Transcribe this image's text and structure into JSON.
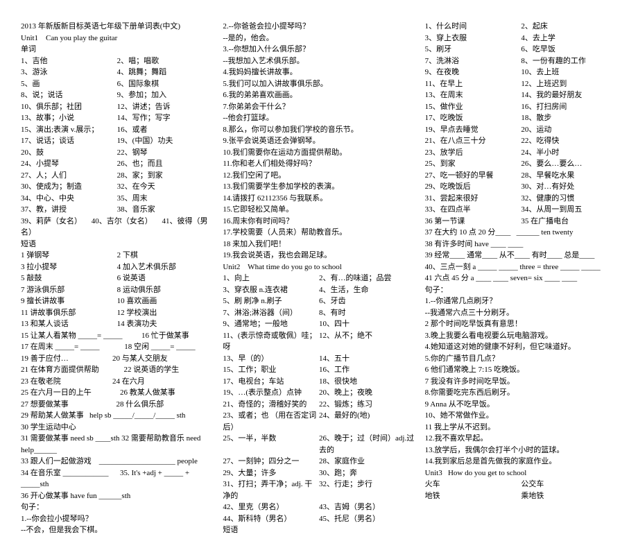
{
  "col1": {
    "title": "2013 年新版新目标英语七年级下册单词表(中文)",
    "unit": "Unit1    Can you play the guitar",
    "section1": "单词",
    "pairs": [
      [
        "1、吉他",
        "2、唱；唱歌"
      ],
      [
        "3、游泳",
        "4、跳舞；舞蹈"
      ],
      [
        "5、画",
        "6、国际象棋"
      ],
      [
        "8、说；说话",
        "9、参加；加入"
      ],
      [
        "10、俱乐部；社团",
        "12、讲述；告诉"
      ],
      [
        "13、故事；小说",
        "14、写作；写字"
      ],
      [
        "15、演出;表演  v.展示；",
        "16、或者"
      ],
      [
        "17、说话；谈话",
        "19、(中国）功夫"
      ],
      [
        "20、鼓",
        "22、钢琴"
      ],
      [
        "24、小提琴",
        "26、也；而且"
      ],
      [
        "27、人；人们",
        "28、家；到家"
      ],
      [
        "30、使成为；制造",
        "32、在今天"
      ],
      [
        "34、中心、中央",
        "35、周末"
      ],
      [
        "37、教，讲授",
        "38、音乐家"
      ]
    ],
    "line_names": "39、莉萨（女名）     40、吉尔（女名）     41、彼得（男名）",
    "section2": "短语",
    "phrase_pairs": [
      [
        "1 弹钢琴",
        "2 下棋"
      ],
      [
        "3 拉小提琴",
        "4 加入艺术俱乐部"
      ],
      [
        "5 敲鼓",
        "6 说英语"
      ],
      [
        "7 游泳俱乐部",
        "8 运动俱乐部"
      ],
      [
        "9 擅长讲故事",
        "10 喜欢画画"
      ],
      [
        "11 讲故事俱乐部",
        "12 学校演出"
      ],
      [
        "13 和某人谈话",
        "14 表演功夫"
      ]
    ],
    "more_lines": [
      "15 让某人看某物 _____= _____          16 忙于做某事",
      "17 在周末 _____= _____             18 空闲 _____= _____",
      "19 善于应付…                       20 与某人交朋友",
      "21 在体育方面提供帮助             22 说英语的学生",
      "23 在敬老院                           24 在六月",
      "25 在六月一日的上午               26 教某人做某事",
      "27 想要做某事                         28 什么俱乐部",
      "29 帮助某人做某事   help sb _____/_____/_____ sth",
      "30 学生运动中心",
      "31 需要做某事 need sb ____sth 32 需要帮助教音乐 need help______",
      "33 跟人们一起做游戏    ____________________ people",
      "34 在音乐室 ____________      35. It's +adj + _____ + _____sth",
      "36 开心做某事 have fun ______sth",
      "句子：",
      "1.--你会拉小提琴吗？",
      "--不会，但是我会下棋。"
    ]
  },
  "col2": {
    "lines": [
      "2.--你爸爸会拉小提琴吗？",
      "--是的，他会。",
      "3.--你想加入什么俱乐部？",
      "--我想加入艺术俱乐部。",
      "4.我妈妈擅长讲故事。",
      "5.我们可以加入讲故事俱乐部。",
      "6.我的弟弟喜欢画画。",
      "7.你弟弟会干什么？",
      "--他会打篮球。",
      "8.那么，你可以参加我们学校的音乐节。",
      "9.张平会说英语还会弹钢琴。",
      "10.我们需要你在运动方面提供帮助。",
      "11.你和老人们相处得好吗？",
      "12.我们空闲了吧。",
      "13.我们需要学生参加学校的表演。",
      "14.请拨打 62112356 与我联系。",
      "15.它即轻松又简单。",
      "16.周末你有时间吗？",
      "17.学校需要（人员来）帮助教音乐。",
      "18 来加入我们吧！",
      "19.我会说英语，我也会踢足球。",
      "",
      "Unit2    What time do you go to school"
    ],
    "pairs": [
      [
        "1、向上",
        "2、有…的味道；品尝"
      ],
      [
        "3、穿衣服  n.连衣裙",
        "4、生活，生命"
      ],
      [
        "5、刷 刷净  n.刷子",
        "6、牙齿"
      ],
      [
        "7、淋浴;淋浴器（间）",
        "8、有时"
      ],
      [
        "9、通常地；一般地",
        "10、四十"
      ],
      [
        "11、(表示惊奇或敬佩）哇；呀",
        "12、从不；绝不"
      ],
      [
        "13、早（的）",
        "14、五十"
      ],
      [
        "15、工作；职业",
        "16、工作"
      ],
      [
        "17、电视台；车站",
        "18、很快地"
      ],
      [
        "19、…(表示整点）点钟",
        "20、晚上；夜晚"
      ],
      [
        "21、奇怪的；滑稽好笑的",
        "22、锻炼；练习"
      ],
      [
        "23、或者；也 （用在否定词后）",
        "24、最好的(地)"
      ],
      [
        "25、一半，半数",
        "26、晚于；过（时间）adj.过去的"
      ],
      [
        "27、一刻钟；四分之一",
        "28、家庭作业"
      ],
      [
        "29、大量；许多",
        "30、跑；奔"
      ],
      [
        "31、打扫；弄干净；adj. 干净的",
        "32、行走；步行"
      ],
      [
        "42、里克（男名）",
        "43、吉姆（男名）"
      ],
      [
        "44、斯科特（男名）",
        "45、托尼（男名）"
      ]
    ],
    "footer": "短语"
  },
  "col3": {
    "pairs": [
      [
        "1、什么时间",
        "2、起床"
      ],
      [
        "3、穿上衣服",
        "4、去上学"
      ],
      [
        "5、刷牙",
        "6、吃早饭"
      ],
      [
        "7、洗淋浴",
        "8、一份有趣的工作"
      ],
      [
        "9、在夜晚",
        "10、去上班"
      ],
      [
        "11、在早上",
        "12、上班迟到"
      ],
      [
        "13、在周末",
        "14、我的最好朋友"
      ],
      [
        "15、做作业",
        "16、打扫房间"
      ],
      [
        "17、吃晚饭",
        "18、散步"
      ],
      [
        "19、早点去睡觉",
        "20、运动"
      ],
      [
        "21、在八点三十分",
        "22、吃得快"
      ],
      [
        "23、放学后",
        "24、半小时"
      ],
      [
        "25、到家",
        "26、要么…要么…"
      ],
      [
        "27、吃一顿好的早餐",
        "28、早餐吃水果"
      ],
      [
        "29、吃晚饭后",
        "30、对…有好处"
      ],
      [
        "31、尝起来很好",
        "32、健康的习惯"
      ],
      [
        "33、在四点半",
        "34、从周一到周五"
      ],
      [
        "36 第一节课",
        "35 在广播电台"
      ]
    ],
    "more_lines": [
      "37 在大约 10 点 20 分____   ______ ten twenty",
      "38 有许多时间 have ____ ____",
      "39 经常____ 通常____ 从不____ 有时____ 总是____",
      "40、三点一刻 a _____ _____ three = three _____ _____",
      "41 六点 45 分 a ____ ____ seven= six ____ ____",
      "句子：",
      "1.--你通常几点刷牙？",
      "--我通常六点三十分刷牙。",
      "2 那个时间吃早饭真有意思！",
      "3.晚上我要么看电视要么玩电脑游戏。",
      "4.她知道这对她的健康不好利，但它味道好。",
      "5.你的广播节目几点？",
      "6 他们通常晚上 7:15 吃晚饭。",
      "7 我没有许多时间吃早饭。",
      "8.你需要吃完东西后刷牙。",
      "9 Anna 从不吃早饭。",
      "10、她不常做作业。",
      "11 我上学从不迟到。",
      "12.我不喜欢早起。",
      "13.放学后，我偶尔会打半个小时的篮球。",
      "14.我到家后总是首先做我的家庭作业。",
      "Unit3   How do you get to school"
    ],
    "end_pairs": [
      [
        "火车",
        "公交车"
      ],
      [
        "地铁",
        "乘地铁"
      ]
    ]
  }
}
